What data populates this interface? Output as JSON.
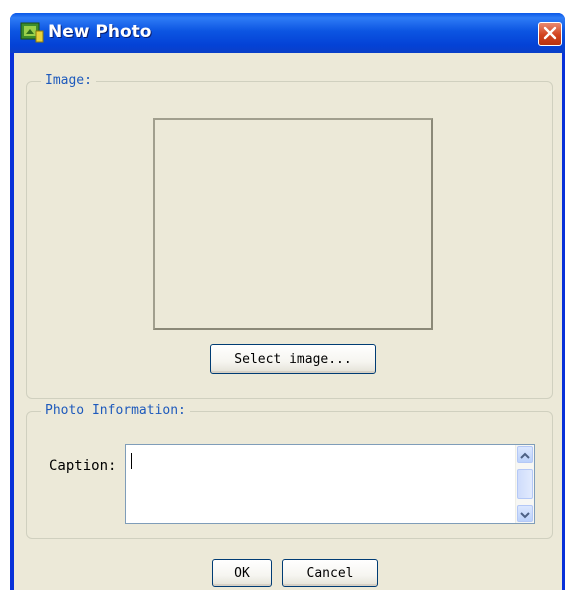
{
  "window": {
    "title": "New Photo",
    "icon": "photo-app-icon",
    "close_icon": "close-icon"
  },
  "image_group": {
    "label": "Image:",
    "select_button_label": "Select image..."
  },
  "info_group": {
    "label": "Photo Information:",
    "caption_label": "Caption:",
    "caption_value": ""
  },
  "buttons": {
    "ok_label": "OK",
    "cancel_label": "Cancel"
  },
  "colors": {
    "titlebar": "#0a58e8",
    "client": "#ece9d8",
    "group_label": "#1e5abc",
    "close": "#d2431f"
  }
}
